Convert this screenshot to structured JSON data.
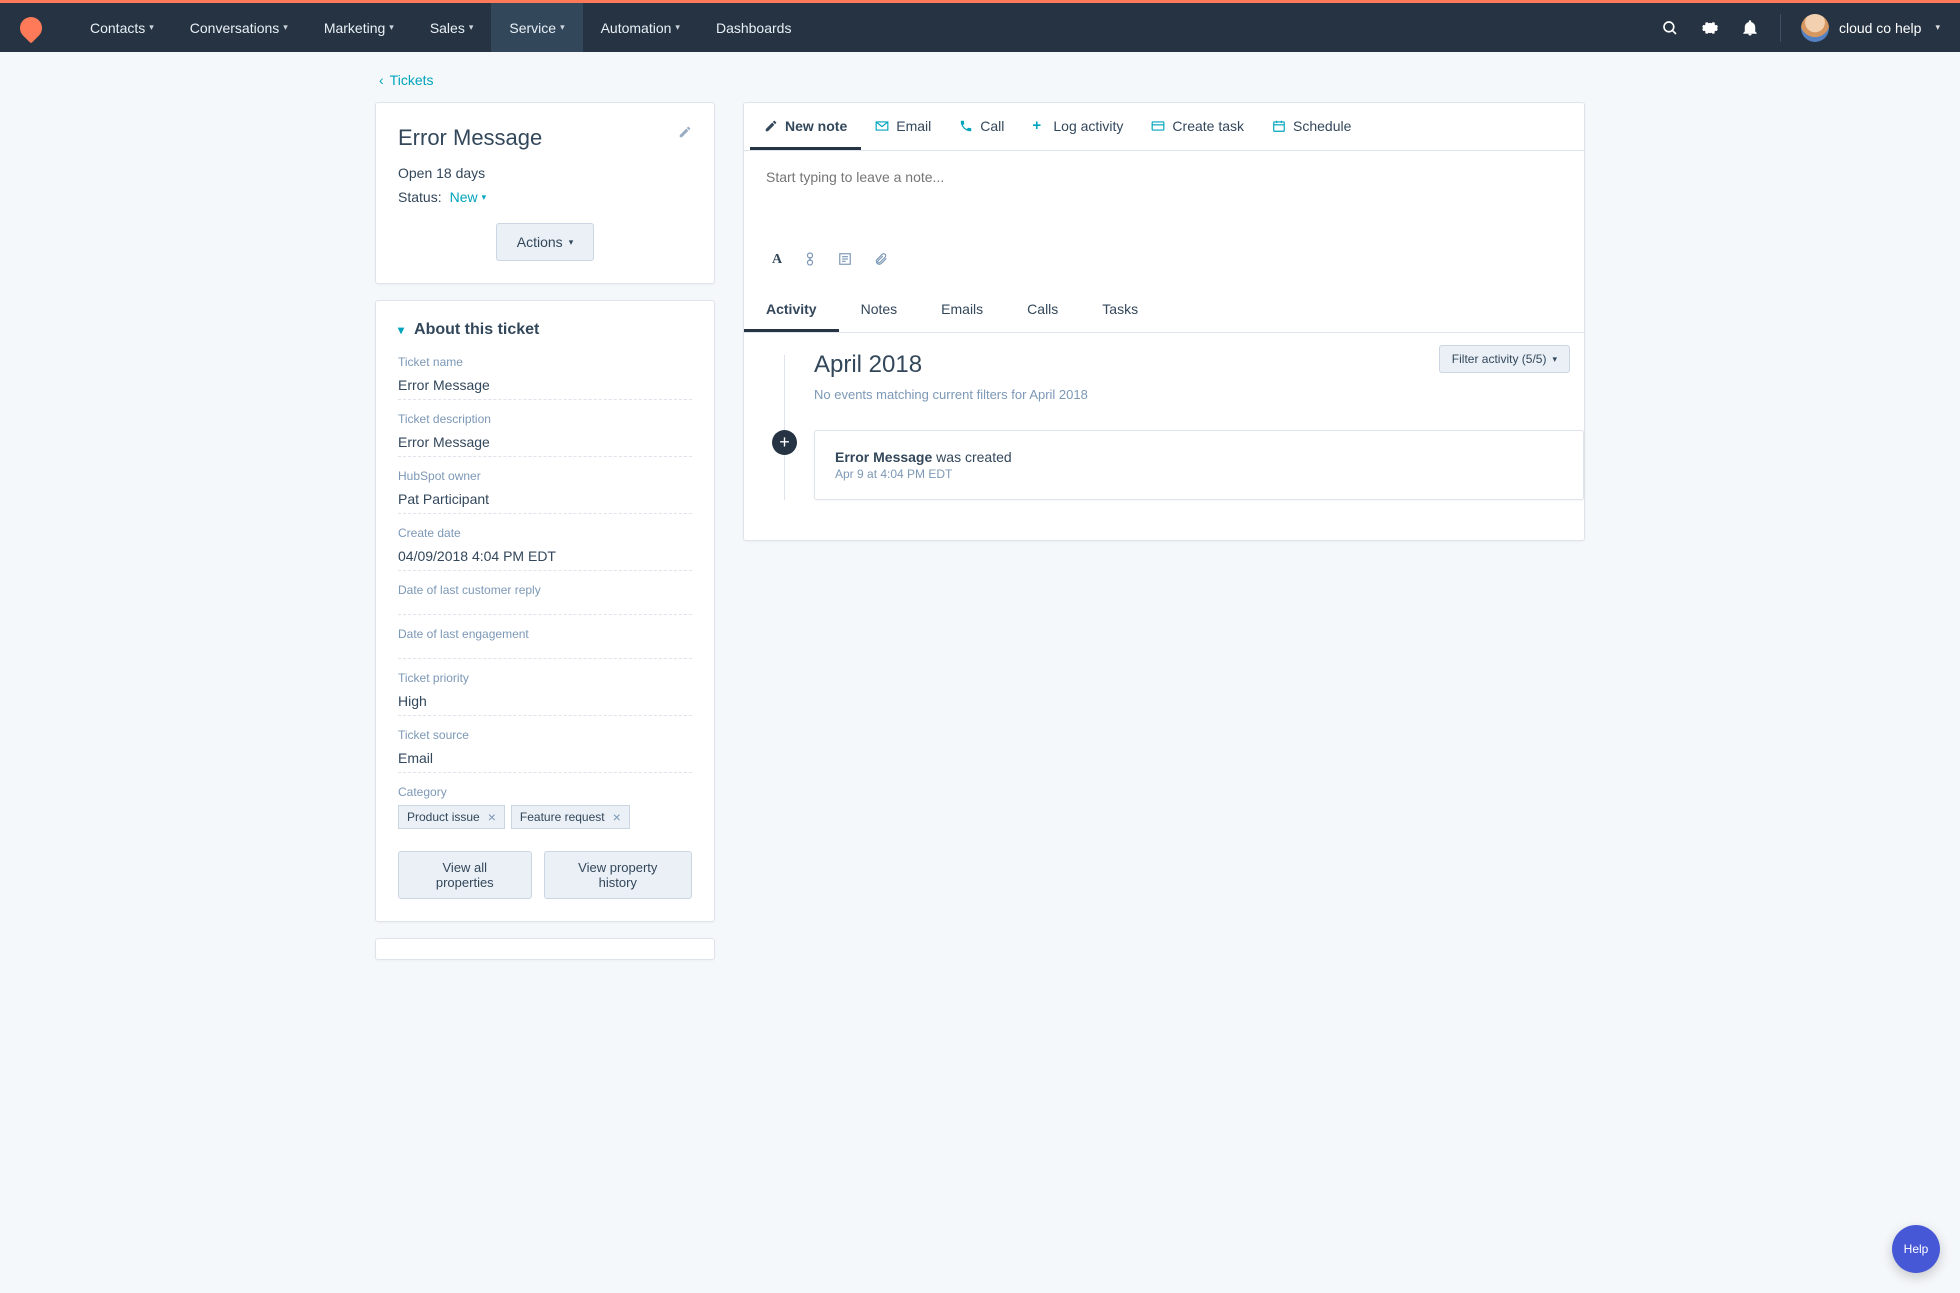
{
  "nav": {
    "items": [
      "Contacts",
      "Conversations",
      "Marketing",
      "Sales",
      "Service",
      "Automation",
      "Dashboards"
    ],
    "active_index": 4,
    "account_label": "cloud co help"
  },
  "back_link": "Tickets",
  "ticket": {
    "title": "Error Message",
    "open_line": "Open 18 days",
    "status_label": "Status:",
    "status_value": "New",
    "actions_label": "Actions"
  },
  "about": {
    "heading": "About this ticket",
    "props": [
      {
        "label": "Ticket name",
        "value": "Error Message"
      },
      {
        "label": "Ticket description",
        "value": "Error Message"
      },
      {
        "label": "HubSpot owner",
        "value": "Pat Participant"
      },
      {
        "label": "Create date",
        "value": "04/09/2018 4:04 PM EDT"
      },
      {
        "label": "Date of last customer reply",
        "value": ""
      },
      {
        "label": "Date of last engagement",
        "value": ""
      },
      {
        "label": "Ticket priority",
        "value": "High"
      },
      {
        "label": "Ticket source",
        "value": "Email"
      }
    ],
    "category_label": "Category",
    "categories": [
      "Product issue",
      "Feature request"
    ],
    "view_all": "View all properties",
    "view_history": "View property history"
  },
  "action_tabs": [
    "New note",
    "Email",
    "Call",
    "Log activity",
    "Create task",
    "Schedule"
  ],
  "note_placeholder": "Start typing to leave a note...",
  "sub_tabs": [
    "Activity",
    "Notes",
    "Emails",
    "Calls",
    "Tasks"
  ],
  "filter_label": "Filter activity (5/5)",
  "timeline": {
    "month": "April 2018",
    "no_events": "No events matching current filters for April 2018",
    "event_strong": "Error Message",
    "event_rest": " was created",
    "event_time": "Apr 9 at 4:04 PM EDT"
  },
  "help_label": "Help"
}
